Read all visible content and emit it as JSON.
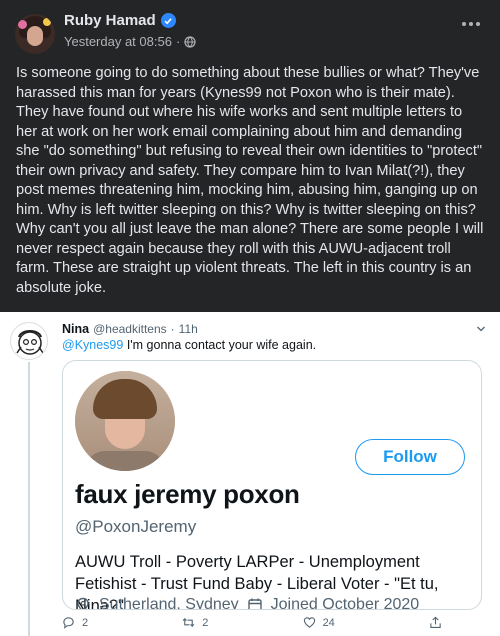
{
  "fb_post": {
    "author": "Ruby Hamad",
    "timestamp": "Yesterday at 08:56",
    "separator": "·",
    "body": "Is someone going to do something about these bullies or what? They've harassed this man for years (Kynes99 not Poxon who is their mate). They have found out where his wife works and sent multiple letters to her at work on her work email complaining about him and demanding she \"do something\" but refusing to reveal their own identities to \"protect\" their own privacy and safety. They compare him to Ivan Milat(?!), they post memes threatening him, mocking him, abusing him, ganging up on him. Why is left twitter sleeping on this? Why is twitter sleeping on this? Why can't you all just leave the man alone? There are some people I will never respect again because they roll with this AUWU-adjacent troll farm. These are straight up violent threats. The left in this country is an absolute joke."
  },
  "tweet": {
    "name": "Nina",
    "handle": "@headkittens",
    "dot": "·",
    "age": "11h",
    "mention": "@Kynes99",
    "text": " I'm gonna contact your wife again.",
    "embedded_profile": {
      "display_name": "faux jeremy poxon",
      "handle": "@PoxonJeremy",
      "bio": "AUWU Troll - Poverty LARPer - Unemployment Fetishist - Trust Fund Baby - Liberal Voter - \"Et tu, Nina?\"",
      "location": "Sutherland, Sydney",
      "joined": "Joined October 2020",
      "follow_label": "Follow"
    },
    "actions": {
      "replies": "2",
      "retweets": "2",
      "likes": "24"
    }
  },
  "colors": {
    "fb_bg": "#242526",
    "fb_text": "#e4e6eb",
    "twitter_blue": "#1d9bf0"
  }
}
